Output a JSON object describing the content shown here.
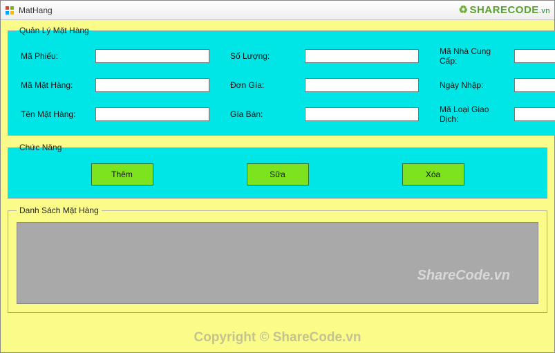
{
  "window": {
    "title": "MatHang"
  },
  "brand": {
    "name": "SHARECODE",
    "tld": ".vn"
  },
  "info": {
    "legend": "Quản Lý Mặt Hàng",
    "fields": {
      "maPhieu": {
        "label": "Mã Phiếu:",
        "value": ""
      },
      "soLuong": {
        "label": "Số Lượng:",
        "value": ""
      },
      "maNhaCungCap": {
        "label": "Mã Nhà Cung Cấp:",
        "value": ""
      },
      "maMatHang": {
        "label": "Mã Mặt Hàng:",
        "value": ""
      },
      "donGia": {
        "label": "Đơn Gía:",
        "value": ""
      },
      "ngayNhap": {
        "label": "Ngày Nhập:",
        "value": ""
      },
      "tenMatHang": {
        "label": "Tên Mặt Hàng:",
        "value": ""
      },
      "giaBan": {
        "label": "Gía Bán:",
        "value": ""
      },
      "maLoaiGiaoDich": {
        "label": "Mã Loại Giao Dịch:",
        "value": ""
      }
    }
  },
  "actions": {
    "legend": "Chức Năng",
    "them": "Thêm",
    "sua": "Sữa",
    "xoa": "Xóa"
  },
  "list": {
    "legend": "Danh Sách Mặt Hàng"
  },
  "watermarks": {
    "inner": "ShareCode.vn",
    "outer": "Copyright © ShareCode.vn"
  }
}
